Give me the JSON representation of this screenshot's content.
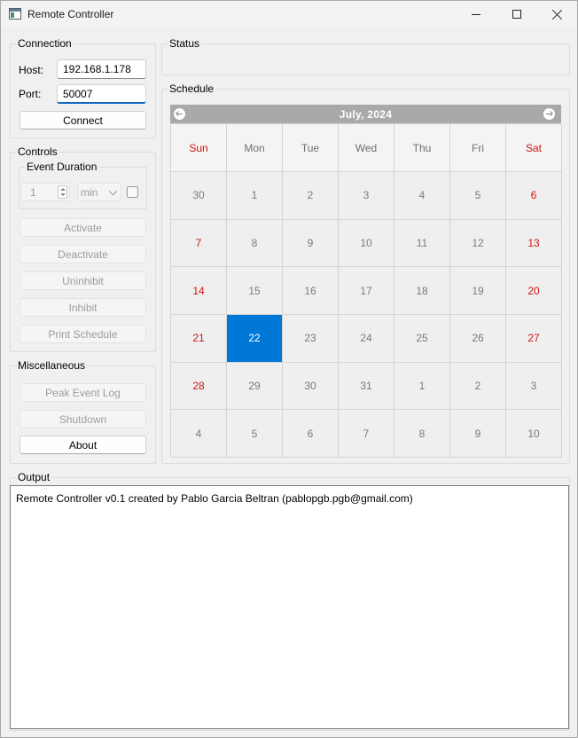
{
  "window": {
    "title": "Remote Controller"
  },
  "connection": {
    "title": "Connection",
    "host_label": "Host:",
    "host_value": "192.168.1.178",
    "port_label": "Port:",
    "port_value": "50007",
    "connect_label": "Connect"
  },
  "controls": {
    "title": "Controls",
    "event_duration_title": "Event Duration",
    "duration_value": "1",
    "unit_value": "min",
    "activate_label": "Activate",
    "deactivate_label": "Deactivate",
    "uninhibit_label": "Uninhibit",
    "inhibit_label": "Inhibit",
    "print_schedule_label": "Print Schedule"
  },
  "misc": {
    "title": "Miscellaneous",
    "peak_event_log_label": "Peak Event Log",
    "shutdown_label": "Shutdown",
    "about_label": "About"
  },
  "status": {
    "title": "Status"
  },
  "schedule": {
    "title": "Schedule",
    "month_year": "July,  2024",
    "weekdays": [
      "Sun",
      "Mon",
      "Tue",
      "Wed",
      "Thu",
      "Fri",
      "Sat"
    ],
    "weeks": [
      [
        "30",
        "1",
        "2",
        "3",
        "4",
        "5",
        "6"
      ],
      [
        "7",
        "8",
        "9",
        "10",
        "11",
        "12",
        "13"
      ],
      [
        "14",
        "15",
        "16",
        "17",
        "18",
        "19",
        "20"
      ],
      [
        "21",
        "22",
        "23",
        "24",
        "25",
        "26",
        "27"
      ],
      [
        "28",
        "29",
        "30",
        "31",
        "1",
        "2",
        "3"
      ],
      [
        "4",
        "5",
        "6",
        "7",
        "8",
        "9",
        "10"
      ]
    ],
    "selected_day": "22",
    "colors": {
      "weekend": "#d11414",
      "selected": "#0078d7",
      "nav_bar": "#a9a9a9"
    }
  },
  "output": {
    "title": "Output",
    "text": "Remote Controller v0.1 created by Pablo Garcia Beltran (pablopgb.pgb@gmail.com)"
  }
}
